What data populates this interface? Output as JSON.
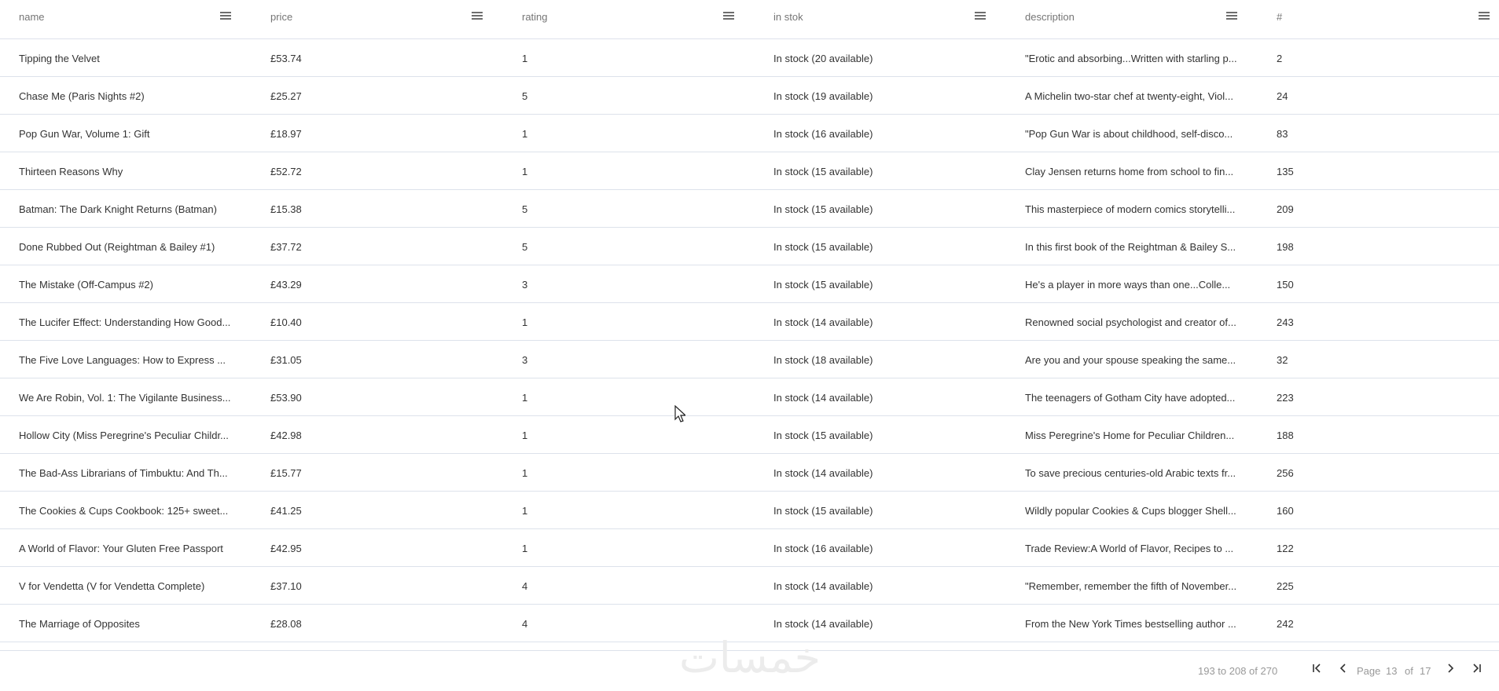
{
  "columns": [
    {
      "key": "name",
      "label": "name"
    },
    {
      "key": "price",
      "label": "price"
    },
    {
      "key": "rating",
      "label": "rating"
    },
    {
      "key": "stock",
      "label": "in stok"
    },
    {
      "key": "description",
      "label": "description"
    },
    {
      "key": "num",
      "label": "#"
    }
  ],
  "rows": [
    {
      "name": "Tipping the Velvet",
      "price": "£53.74",
      "rating": "1",
      "stock": "In stock (20 available)",
      "description": "\"Erotic and absorbing...Written with starling p...",
      "num": "2"
    },
    {
      "name": "Chase Me (Paris Nights #2)",
      "price": "£25.27",
      "rating": "5",
      "stock": "In stock (19 available)",
      "description": "A Michelin two-star chef at twenty-eight, Viol...",
      "num": "24"
    },
    {
      "name": "Pop Gun War, Volume 1: Gift",
      "price": "£18.97",
      "rating": "1",
      "stock": "In stock (16 available)",
      "description": "\"Pop Gun War is about childhood, self-disco...",
      "num": "83"
    },
    {
      "name": "Thirteen Reasons Why",
      "price": "£52.72",
      "rating": "1",
      "stock": "In stock (15 available)",
      "description": "Clay Jensen returns home from school to fin...",
      "num": "135"
    },
    {
      "name": "Batman: The Dark Knight Returns (Batman)",
      "price": "£15.38",
      "rating": "5",
      "stock": "In stock (15 available)",
      "description": "This masterpiece of modern comics storytelli...",
      "num": "209"
    },
    {
      "name": "Done Rubbed Out (Reightman & Bailey #1)",
      "price": "£37.72",
      "rating": "5",
      "stock": "In stock (15 available)",
      "description": "In this first book of the Reightman & Bailey S...",
      "num": "198"
    },
    {
      "name": "The Mistake (Off-Campus #2)",
      "price": "£43.29",
      "rating": "3",
      "stock": "In stock (15 available)",
      "description": "He's a player in more ways than one...Colle...",
      "num": "150"
    },
    {
      "name": "The Lucifer Effect: Understanding How Good...",
      "price": "£10.40",
      "rating": "1",
      "stock": "In stock (14 available)",
      "description": "Renowned social psychologist and creator of...",
      "num": "243"
    },
    {
      "name": "The Five Love Languages: How to Express ...",
      "price": "£31.05",
      "rating": "3",
      "stock": "In stock (18 available)",
      "description": "Are you and your spouse speaking the same...",
      "num": "32"
    },
    {
      "name": "We Are Robin, Vol. 1: The Vigilante Business...",
      "price": "£53.90",
      "rating": "1",
      "stock": "In stock (14 available)",
      "description": "The teenagers of Gotham City have adopted...",
      "num": "223"
    },
    {
      "name": "Hollow City (Miss Peregrine's Peculiar Childr...",
      "price": "£42.98",
      "rating": "1",
      "stock": "In stock (15 available)",
      "description": "Miss Peregrine's Home for Peculiar Children...",
      "num": "188"
    },
    {
      "name": "The Bad-Ass Librarians of Timbuktu: And Th...",
      "price": "£15.77",
      "rating": "1",
      "stock": "In stock (14 available)",
      "description": "To save precious centuries-old Arabic texts fr...",
      "num": "256"
    },
    {
      "name": "The Cookies & Cups Cookbook: 125+ sweet...",
      "price": "£41.25",
      "rating": "1",
      "stock": "In stock (15 available)",
      "description": "Wildly popular Cookies & Cups blogger Shell...",
      "num": "160"
    },
    {
      "name": "A World of Flavor: Your Gluten Free Passport",
      "price": "£42.95",
      "rating": "1",
      "stock": "In stock (16 available)",
      "description": "Trade Review:A World of Flavor, Recipes to ...",
      "num": "122"
    },
    {
      "name": "V for Vendetta (V for Vendetta Complete)",
      "price": "£37.10",
      "rating": "4",
      "stock": "In stock (14 available)",
      "description": "\"Remember, remember the fifth of November...",
      "num": "225"
    },
    {
      "name": "The Marriage of Opposites",
      "price": "£28.08",
      "rating": "4",
      "stock": "In stock (14 available)",
      "description": "From the New York Times bestselling author ...",
      "num": "242"
    }
  ],
  "pagination": {
    "summary": "193 to 208 of 270",
    "page_word": "Page",
    "current_page": "13",
    "of_word": "of",
    "total_pages": "17"
  },
  "watermark": "خمسات"
}
